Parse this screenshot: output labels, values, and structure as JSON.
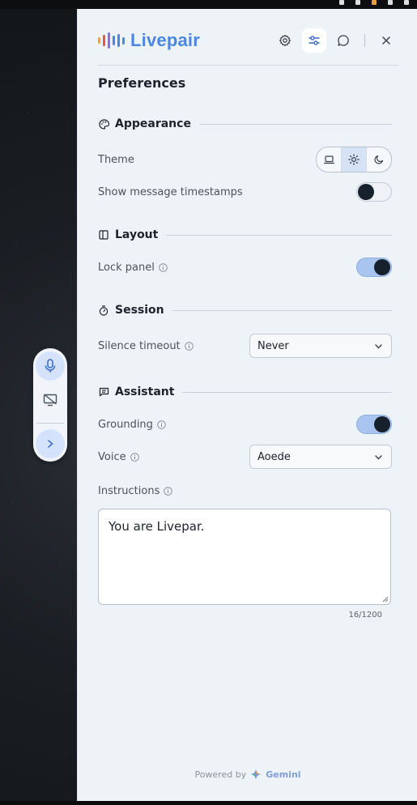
{
  "app": {
    "name": "Livepair",
    "brand_color": "#4a86e8"
  },
  "header": {
    "buttons": [
      {
        "icon": "gear-icon",
        "label": "Settings"
      },
      {
        "icon": "sliders-icon",
        "label": "Preferences",
        "active": true
      },
      {
        "icon": "chat-icon",
        "label": "Chat"
      },
      {
        "icon": "close-icon",
        "label": "Close"
      }
    ]
  },
  "page": {
    "title": "Preferences"
  },
  "sections": {
    "appearance": {
      "title": "Appearance",
      "icon": "palette-icon",
      "theme_label": "Theme",
      "theme_options": [
        "laptop-icon",
        "sun-icon",
        "moon-icon"
      ],
      "theme_selected": "sun-icon",
      "timestamps_label": "Show message timestamps",
      "timestamps_on": false
    },
    "layout": {
      "title": "Layout",
      "icon": "panel-icon",
      "lock_label": "Lock panel",
      "lock_on": true
    },
    "session": {
      "title": "Session",
      "icon": "stopwatch-icon",
      "silence_label": "Silence timeout",
      "silence_value": "Never"
    },
    "assistant": {
      "title": "Assistant",
      "icon": "message-square-icon",
      "grounding_label": "Grounding",
      "grounding_on": true,
      "voice_label": "Voice",
      "voice_value": "Aoede",
      "instructions_label": "Instructions",
      "instructions_value": "You are Livepar.",
      "instructions_counter": "16/1200"
    }
  },
  "footer": {
    "powered_by": "Powered by",
    "provider": "Gemini"
  },
  "dock": {
    "buttons": [
      "microphone-icon",
      "screen-share-off-icon",
      "chevron-right-icon"
    ]
  }
}
